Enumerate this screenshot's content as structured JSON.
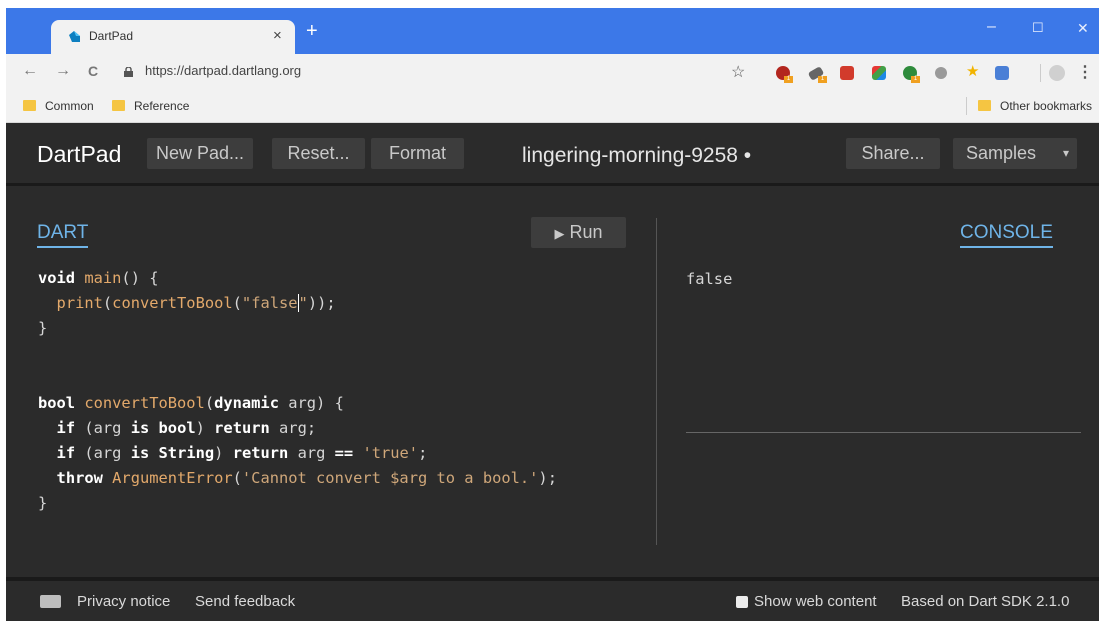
{
  "browser": {
    "tab_title": "DartPad",
    "tab_close": "×",
    "new_tab": "+",
    "window_controls": {
      "minimize": "–",
      "maximize": "☐",
      "close": "✕"
    },
    "nav": {
      "back": "←",
      "forward": "→",
      "reload": "C"
    },
    "url": "https://dartpad.dartlang.org",
    "bookmark_star": "☆",
    "menu": "⋮",
    "extensions": [
      {
        "icon": "extension-red-icon",
        "color": "#b3261e",
        "badge": "1"
      },
      {
        "icon": "extension-gray-icon",
        "color": "#666666",
        "badge": "1"
      },
      {
        "icon": "extension-red-box-icon",
        "color": "#d23b2c"
      },
      {
        "icon": "extension-colorful-icon",
        "color": "#4a8f3c"
      },
      {
        "icon": "extension-green-icon",
        "color": "#2e8b3c",
        "badge": "1"
      },
      {
        "icon": "extension-disc-icon",
        "color": "#9a9a9a"
      },
      {
        "icon": "extension-star-icon",
        "color": "#f2b400"
      },
      {
        "icon": "extension-translate-icon",
        "color": "#4a7fd6"
      },
      {
        "icon": "profile-icon",
        "color": "#d0d0d0"
      }
    ],
    "bookmarks": {
      "items": [
        "Common",
        "Reference"
      ],
      "other": "Other bookmarks"
    }
  },
  "dartpad": {
    "logo": "DartPad",
    "buttons": {
      "new_pad": "New Pad...",
      "reset": "Reset...",
      "format": "Format",
      "share": "Share...",
      "samples": "Samples",
      "samples_arrow": "▾"
    },
    "pad_name": "lingering-morning-9258 •",
    "dart_tab": "DART",
    "run_label": "Run",
    "run_icon": "▶",
    "console_tab": "CONSOLE",
    "console_output": "false",
    "code": {
      "l1_kw": "void",
      "l1_fn": " main",
      "l1_rest": "() {",
      "l2_indent": "  ",
      "l2_fn": "print",
      "l2_a": "(",
      "l2_call": "convertToBool",
      "l2_b": "(",
      "l2_str": "\"false",
      "l2_str_end": "\"",
      "l2_end": "));",
      "l3": "}",
      "l6_kw1": "bool",
      "l6_fn": " convertToBool",
      "l6_a": "(",
      "l6_kw2": "dynamic",
      "l6_b": " arg) {",
      "l7_indent": "  ",
      "l7_kw1": "if",
      "l7_a": " (arg ",
      "l7_kw2": "is",
      "l7_b": " ",
      "l7_kw3": "bool",
      "l7_c": ") ",
      "l7_kw4": "return",
      "l7_d": " arg;",
      "l8_indent": "  ",
      "l8_kw1": "if",
      "l8_a": " (arg ",
      "l8_kw2": "is",
      "l8_b": " ",
      "l8_kw3": "String",
      "l8_c": ") ",
      "l8_kw4": "return",
      "l8_d": " arg ",
      "l8_op": "==",
      "l8_e": " ",
      "l8_str": "'true'",
      "l8_f": ";",
      "l9_indent": "  ",
      "l9_kw": "throw",
      "l9_fn": " ArgumentError",
      "l9_a": "(",
      "l9_str": "'Cannot convert $arg to a bool.'",
      "l9_b": ");",
      "l10": "}"
    },
    "footer": {
      "privacy": "Privacy notice",
      "feedback": "Send feedback",
      "show_web": "Show web content",
      "sdk": "Based on Dart SDK 2.1.0"
    }
  }
}
